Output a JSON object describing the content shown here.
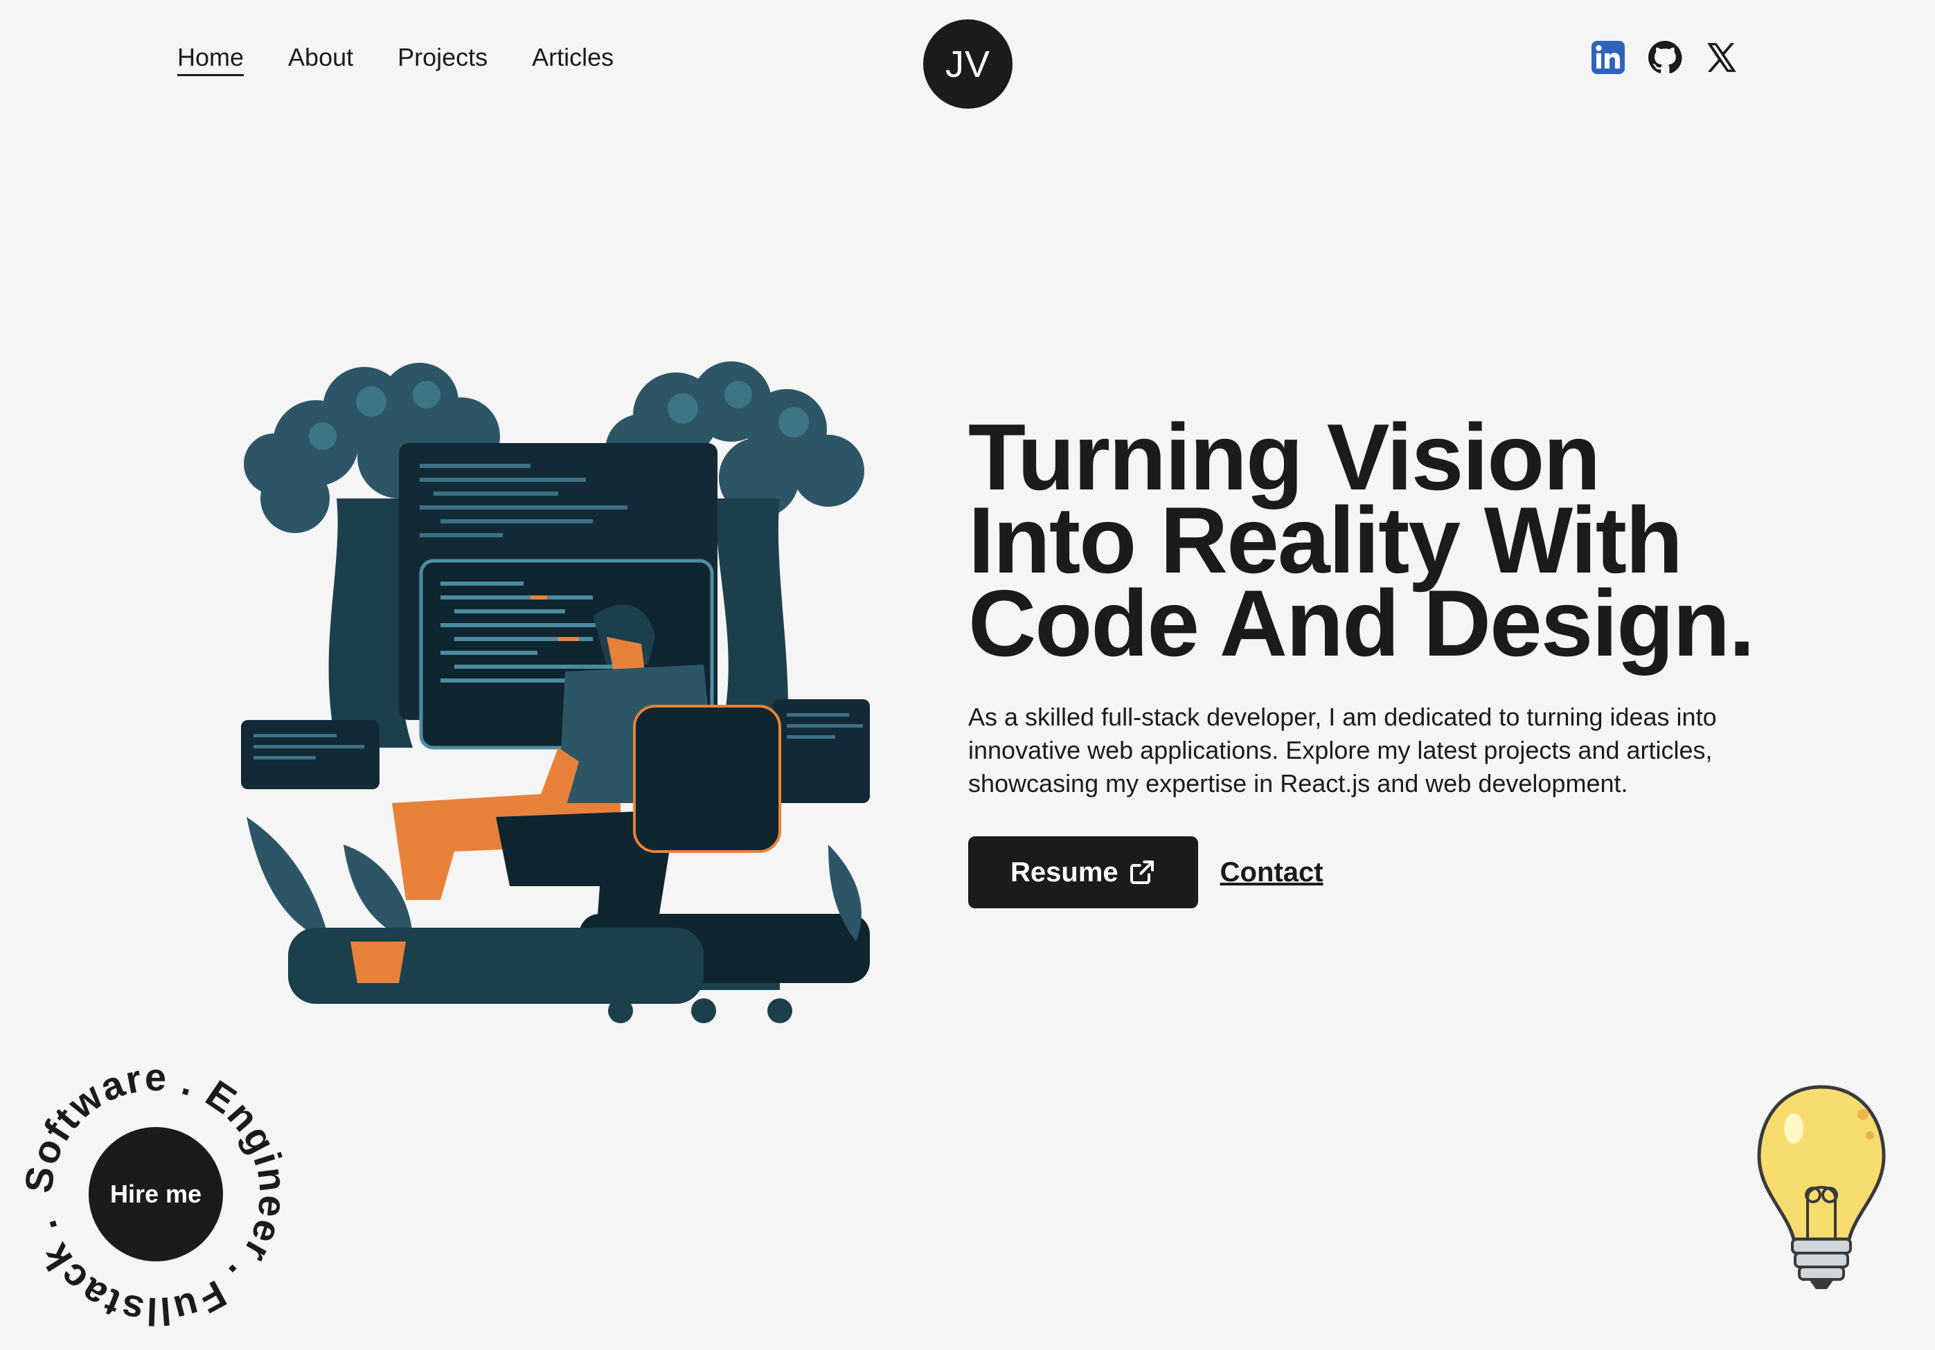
{
  "nav": {
    "items": [
      {
        "label": "Home",
        "active": true
      },
      {
        "label": "About"
      },
      {
        "label": "Projects"
      },
      {
        "label": "Articles"
      }
    ]
  },
  "logo": {
    "initials": "JV"
  },
  "socials": {
    "icons": [
      "linkedin-icon",
      "github-icon",
      "x-twitter-icon"
    ]
  },
  "hero": {
    "headline": "Turning Vision Into Reality With Code And Design.",
    "intro": "As a skilled full-stack developer, I am dedicated to turning ideas into innovative web applications. Explore my latest projects and articles, showcasing my expertise in React.js and web development.",
    "resume_label": "Resume",
    "contact_label": "Contact"
  },
  "badge": {
    "hire_label": "Hire me",
    "ring_text": "Software . Engineer . Fullstack ."
  },
  "colors": {
    "background": "#f5f5f5",
    "dark": "#1b1b1b",
    "illustration_teal": "#2c5666",
    "illustration_orange": "#e8823a",
    "linkedin_blue": "#2e64bc",
    "bulb_yellow": "#f7dc6f"
  }
}
